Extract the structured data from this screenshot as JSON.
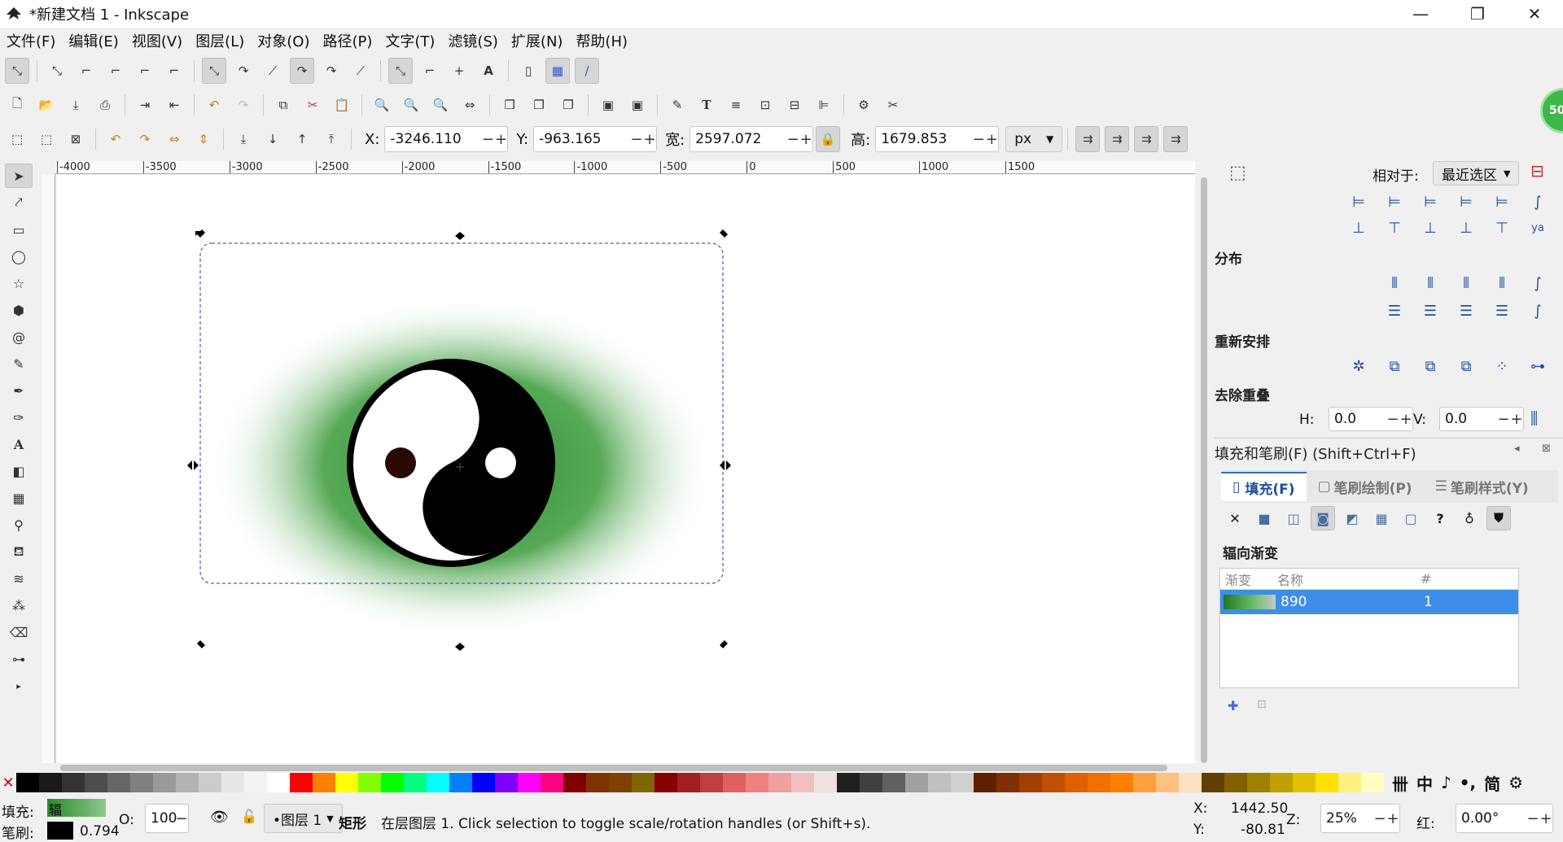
{
  "window": {
    "title": "*新建文档 1 - Inkscape",
    "minimize": "—",
    "maximize": "❐",
    "close": "✕"
  },
  "menu": [
    "文件(F)",
    "编辑(E)",
    "视图(V)",
    "图层(L)",
    "对象(O)",
    "路径(P)",
    "文字(T)",
    "滤镜(S)",
    "扩展(N)",
    "帮助(H)"
  ],
  "selector_toolbar": {
    "x_label": "X:",
    "x_value": "-3246.110",
    "y_label": "Y:",
    "y_value": "-963.165",
    "w_label": "宽:",
    "w_value": "2597.072",
    "h_label": "高:",
    "h_value": "1679.853",
    "unit": "px"
  },
  "ruler_ticks": [
    "-4000",
    "-3500",
    "-3000",
    "-2500",
    "-2000",
    "-1500",
    "-1000",
    "-500",
    "0",
    "500",
    "1000",
    "1500"
  ],
  "align_panel": {
    "relative_label": "相对于:",
    "relative_value": "最近选区",
    "distribute": "分布",
    "rearrange": "重新安排",
    "remove_overlap": "去除重叠",
    "h_label": "H:",
    "h_value": "0.0",
    "v_label": "V:",
    "v_value": "0.0"
  },
  "fill_stroke": {
    "title": "填充和笔刷(F) (Shift+Ctrl+F)",
    "tabs": [
      "填充(F)",
      "笔刷绘制(P)",
      "笔刷样式(Y)"
    ],
    "gradient_type": "辐向渐变",
    "table_headers": [
      "渐变",
      "名称",
      "#"
    ],
    "gradient_name": "890",
    "gradient_count": "1"
  },
  "status": {
    "fill_label": "填充:",
    "fill_value": "辐",
    "stroke_label": "笔刷:",
    "stroke_value": "0.794",
    "opacity_label": "O:",
    "opacity_value": "100",
    "layer": "•图层 1",
    "message_type": "矩形",
    "message": "在层图层 1. Click selection to toggle scale/rotation handles (or Shift+s).",
    "cx_label": "X:",
    "cx_value": "1442.50",
    "cy_label": "Y:",
    "cy_value": "-80.81",
    "zoom_label": "Z:",
    "zoom_value": "25%",
    "rot_label": "红:",
    "rot_value": "0.00°"
  },
  "colors": {
    "accent": "#2a6fd6",
    "selection": "#3d8ee8",
    "gradient_green": "#3a9a3a"
  }
}
